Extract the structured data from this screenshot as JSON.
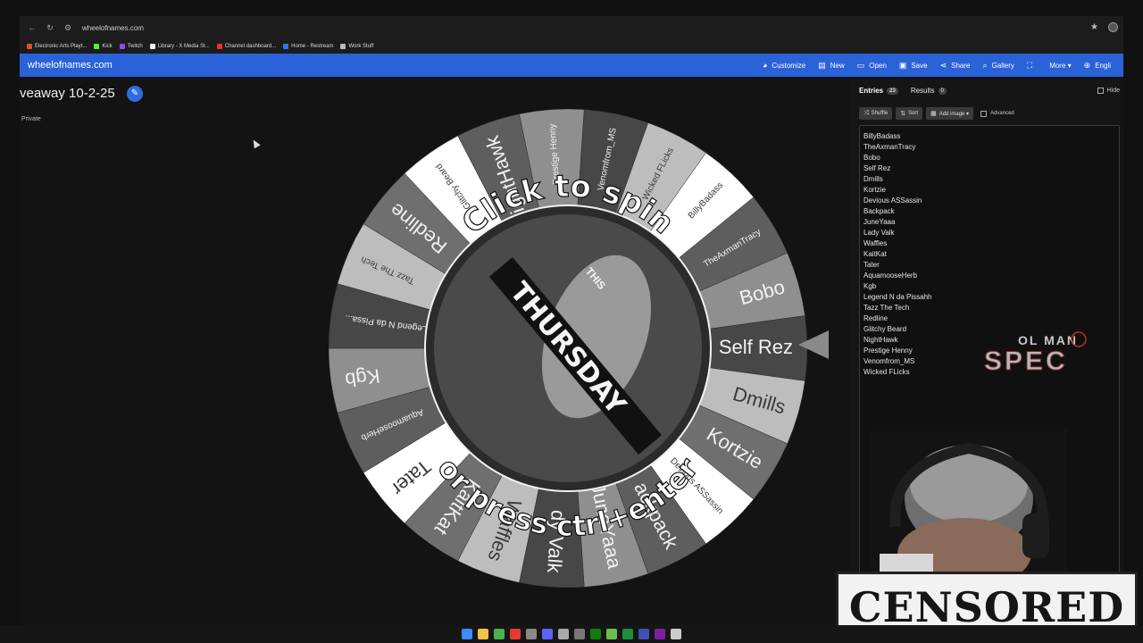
{
  "browser": {
    "url": "wheelofnames.com",
    "bookmarks": [
      {
        "label": "Electronic Arts Playt...",
        "color": "#e04a3a"
      },
      {
        "label": "Kick",
        "color": "#53fc18"
      },
      {
        "label": "Twitch",
        "color": "#9146ff"
      },
      {
        "label": "Library - X Media St...",
        "color": "#eeeeee"
      },
      {
        "label": "Channel dashboard...",
        "color": "#ff2b2b"
      },
      {
        "label": "Home - Restream",
        "color": "#3b6ff5"
      },
      {
        "label": "Work Stuff",
        "color": "#bbbbbb"
      }
    ]
  },
  "appbar": {
    "brand": "wheelofnames.com",
    "menu": [
      {
        "label": "Customize",
        "icon": "palette-icon",
        "glyph": "◕"
      },
      {
        "label": "New",
        "icon": "document-icon",
        "glyph": "▤"
      },
      {
        "label": "Open",
        "icon": "folder-icon",
        "glyph": "▭"
      },
      {
        "label": "Save",
        "icon": "save-icon",
        "glyph": "▣"
      },
      {
        "label": "Share",
        "icon": "share-icon",
        "glyph": "⋖"
      },
      {
        "label": "Gallery",
        "icon": "search-icon",
        "glyph": "⌕"
      },
      {
        "label": "",
        "icon": "fullscreen-icon",
        "glyph": "⛶"
      },
      {
        "label": "More ▾",
        "icon": "",
        "glyph": ""
      },
      {
        "label": "Engli",
        "icon": "globe-icon",
        "glyph": "⊕"
      }
    ]
  },
  "page": {
    "title": "veaway 10-2-25",
    "privacy": "Private"
  },
  "wheel": {
    "spin_text_top": "Click to spin",
    "spin_text_bottom": "or press ctrl+enter",
    "center_text": "THURSDAY",
    "center_text_small": "THIS",
    "segments": [
      "BillyBadass",
      "TheAxmanTracy",
      "Bobo",
      "Self Rez",
      "Dmills",
      "Kortzie",
      "Devious ASSassin",
      "Backpack",
      "JuneYaaa",
      "Lady Valk",
      "Waffles",
      "KaitKat",
      "Tater",
      "AquamooseHerb",
      "Kgb",
      "Legend N da Pissahh",
      "Tazz The Tech",
      "Redline",
      "Glitchy Beard",
      "NightHawk",
      "Prestige Henny",
      "Venomfrom_MS",
      "Wicked FLicks"
    ],
    "visible_labels": [
      "BillyBadass",
      "TheAxmanTracy",
      "Bobo",
      "Self Rez",
      "Dmills",
      "Kortzie",
      "Devious ASSassin",
      "ackpack",
      "JuneYaaa",
      "dy Valk",
      "Waffles",
      "KaitKat",
      "Tater",
      "AquamooseHerb",
      "Kgb",
      "Legend N da Pissa...",
      "Tazz The Tech",
      "Redline",
      "Glitchy Beard",
      "NightHawk",
      "Prestige Henny",
      "Venomfrom_MS",
      "Wicked FLicks"
    ]
  },
  "panel": {
    "tab_entries": "Entries",
    "entries_count": "23",
    "tab_results": "Results",
    "results_count": "0",
    "hide_label": "Hide",
    "shuffle": "Shuffle",
    "sort": "Sort",
    "add_image": "Add image ▾",
    "advanced": "Advanced",
    "entries": [
      "BillyBadass",
      "TheAxmanTracy",
      "Bobo",
      "Self Rez",
      "Dmills",
      "Kortzie",
      "Devious ASSassin",
      "Backpack",
      "JuneYaaa",
      "Lady Valk",
      "Waffles",
      "KaitKat",
      "Tater",
      "AquamooseHerb",
      "Kgb",
      "Legend N da Pissahh",
      "Tazz The Tech",
      "Redline",
      "Glitchy Beard",
      "NightHawk",
      "Prestige Henny",
      "Venomfrom_MS",
      "Wicked FLicks"
    ]
  },
  "overlay": {
    "logo_top": "OL MAN",
    "logo_bottom": "SPEC",
    "censored": "CENSORED"
  },
  "taskbar": {
    "icons": [
      {
        "name": "start-icon",
        "color": "#3a8cff"
      },
      {
        "name": "files-icon",
        "color": "#f2c14e"
      },
      {
        "name": "chrome-icon",
        "color": "#4caf50"
      },
      {
        "name": "chrome-alt-icon",
        "color": "#e53935"
      },
      {
        "name": "app-icon",
        "color": "#888888"
      },
      {
        "name": "discord-icon",
        "color": "#5865f2"
      },
      {
        "name": "app2-icon",
        "color": "#aaaaaa"
      },
      {
        "name": "app3-icon",
        "color": "#777777"
      },
      {
        "name": "xbox-icon",
        "color": "#107c10"
      },
      {
        "name": "app4-icon",
        "color": "#6abf4b"
      },
      {
        "name": "sheets-icon",
        "color": "#1e8e3e"
      },
      {
        "name": "app5-icon",
        "color": "#3f51b5"
      },
      {
        "name": "app6-icon",
        "color": "#7b1fa2"
      },
      {
        "name": "app7-icon",
        "color": "#cccccc"
      }
    ]
  }
}
